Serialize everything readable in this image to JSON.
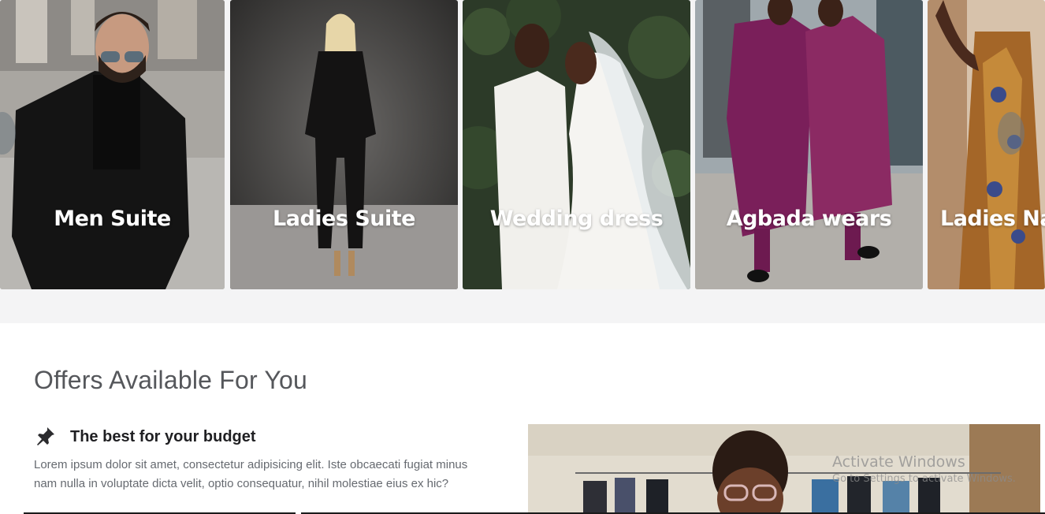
{
  "carousel": {
    "cards": [
      {
        "label": "Men Suite",
        "image": "man in black suit photo"
      },
      {
        "label": "Ladies Suite",
        "image": "woman in black suit photo"
      },
      {
        "label": "Wedding dress",
        "image": "bride and groom photo"
      },
      {
        "label": "Agbada wears",
        "image": "two men in agbada photo"
      },
      {
        "label": "Ladies Na",
        "image": "woman in printed dress photo"
      }
    ],
    "prev_icon": "chevron-left-icon",
    "next_icon": "chevron-right-icon"
  },
  "offers": {
    "title": "Offers Available For You",
    "items": [
      {
        "icon": "pin-icon",
        "heading": "The best for your budget",
        "text": "Lorem ipsum dolor sit amet, consectetur adipisicing elit. Iste obcaecati fugiat minus nam nulla in voluptate dicta velit, optio consequatur, nihil molestiae eius ex hic?"
      }
    ],
    "image": "woman with glasses in clothing store photo"
  },
  "watermark": {
    "title": "Activate Windows",
    "subtitle": "Go to Settings to activate Windows."
  },
  "colors": {
    "carousel_bg": "#f4f4f5",
    "title": "#55575b",
    "heading": "#1f1f22",
    "body_text": "#666a70"
  }
}
